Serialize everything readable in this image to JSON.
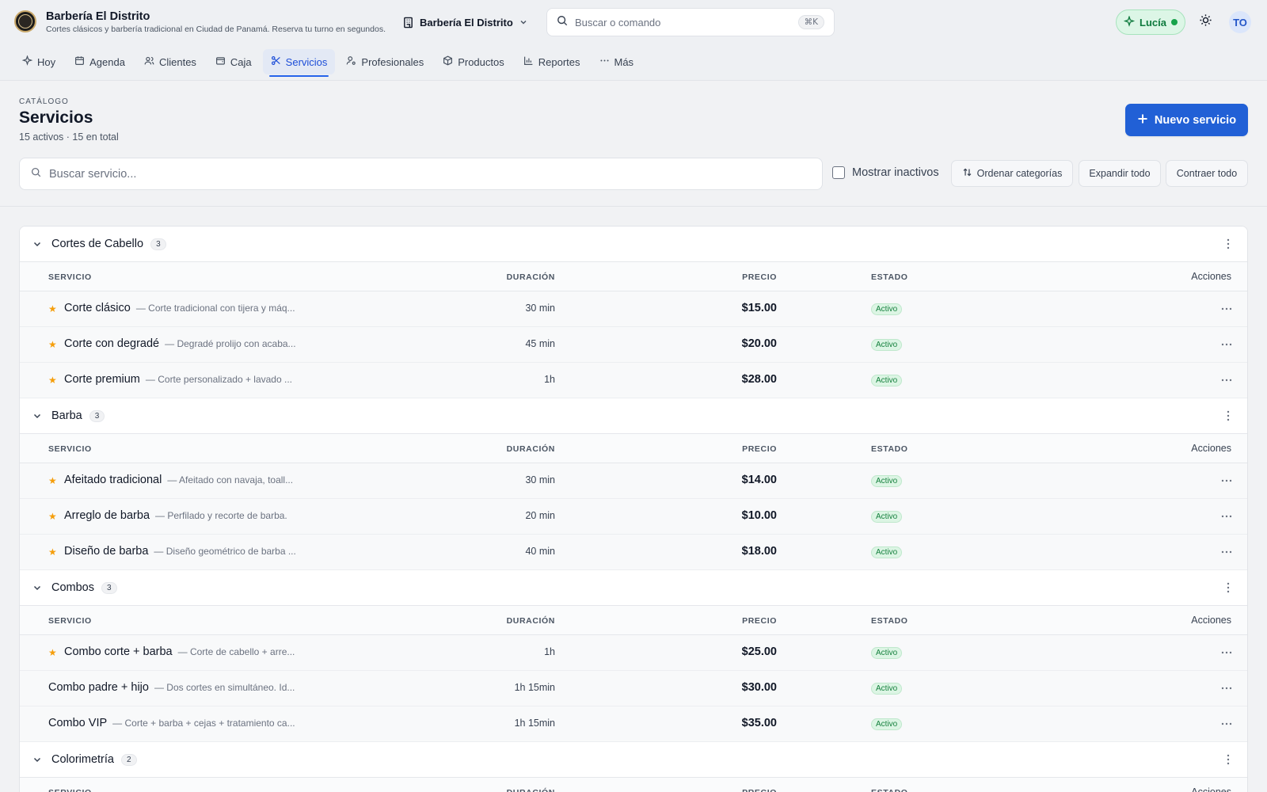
{
  "brand": {
    "title": "Barbería El Distrito",
    "subtitle": "Cortes clásicos y barbería tradicional en Ciudad de Panamá. Reserva tu turno en segundos."
  },
  "business_selector": {
    "label": "Barbería El Distrito"
  },
  "command_search": {
    "placeholder": "Buscar o comando",
    "shortcut": "⌘K"
  },
  "assistant": {
    "label": "Lucía"
  },
  "user": {
    "initials": "TO"
  },
  "nav": [
    {
      "label": "Hoy",
      "icon": "sparkle-icon"
    },
    {
      "label": "Agenda",
      "icon": "calendar-icon"
    },
    {
      "label": "Clientes",
      "icon": "users-icon"
    },
    {
      "label": "Caja",
      "icon": "wallet-icon"
    },
    {
      "label": "Servicios",
      "icon": "scissors-icon",
      "active": true
    },
    {
      "label": "Profesionales",
      "icon": "user-cog-icon"
    },
    {
      "label": "Productos",
      "icon": "package-icon"
    },
    {
      "label": "Reportes",
      "icon": "bar-chart-icon"
    },
    {
      "label": "Más",
      "icon": "more-horizontal-icon"
    }
  ],
  "page": {
    "eyebrow": "CATÁLOGO",
    "title": "Servicios",
    "subtitle": "15 activos · 15 en total",
    "new_button": "Nuevo servicio"
  },
  "toolbar": {
    "search_placeholder": "Buscar servicio...",
    "show_inactive": "Mostrar inactivos",
    "sort_categories": "Ordenar categorías",
    "expand_all": "Expandir todo",
    "collapse_all": "Contraer todo"
  },
  "columns": {
    "service": "SERVICIO",
    "duration": "DURACIÓN",
    "price": "PRECIO",
    "status": "ESTADO",
    "actions": "Acciones"
  },
  "colors": {
    "accent": "#2160d6",
    "star": "#f59e0b",
    "status_active": "#15803d"
  },
  "categories": [
    {
      "name": "Cortes de Cabello",
      "count": "3",
      "services": [
        {
          "name": "Corte clásico",
          "desc": "— Corte tradicional con tijera y máq...",
          "duration": "30 min",
          "price": "$15.00",
          "status": "Activo",
          "featured": true
        },
        {
          "name": "Corte con degradé",
          "desc": "— Degradé prolijo con acaba...",
          "duration": "45 min",
          "price": "$20.00",
          "status": "Activo",
          "featured": true
        },
        {
          "name": "Corte premium",
          "desc": "— Corte personalizado + lavado ...",
          "duration": "1h",
          "price": "$28.00",
          "status": "Activo",
          "featured": true
        }
      ]
    },
    {
      "name": "Barba",
      "count": "3",
      "services": [
        {
          "name": "Afeitado tradicional",
          "desc": "— Afeitado con navaja, toall...",
          "duration": "30 min",
          "price": "$14.00",
          "status": "Activo",
          "featured": true
        },
        {
          "name": "Arreglo de barba",
          "desc": "— Perfilado y recorte de barba.",
          "duration": "20 min",
          "price": "$10.00",
          "status": "Activo",
          "featured": true
        },
        {
          "name": "Diseño de barba",
          "desc": "— Diseño geométrico de barba ...",
          "duration": "40 min",
          "price": "$18.00",
          "status": "Activo",
          "featured": true
        }
      ]
    },
    {
      "name": "Combos",
      "count": "3",
      "services": [
        {
          "name": "Combo corte + barba",
          "desc": "— Corte de cabello + arre...",
          "duration": "1h",
          "price": "$25.00",
          "status": "Activo",
          "featured": true
        },
        {
          "name": "Combo padre + hijo",
          "desc": "— Dos cortes en simultáneo. Id...",
          "duration": "1h 15min",
          "price": "$30.00",
          "status": "Activo",
          "featured": false
        },
        {
          "name": "Combo VIP",
          "desc": "— Corte + barba + cejas + tratamiento ca...",
          "duration": "1h 15min",
          "price": "$35.00",
          "status": "Activo",
          "featured": false
        }
      ]
    },
    {
      "name": "Colorimetría",
      "count": "2",
      "services": []
    }
  ]
}
